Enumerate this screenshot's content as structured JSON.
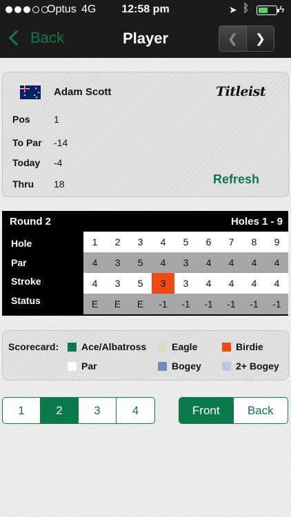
{
  "status_bar": {
    "signal_dots_filled": 3,
    "signal_dots_total": 5,
    "carrier": "Optus",
    "network": "4G",
    "time": "12:58 pm",
    "battery_level": 0.55,
    "icons": [
      "location-arrow-icon",
      "bluetooth-icon",
      "battery-icon",
      "charging-bolt-icon"
    ]
  },
  "nav": {
    "back_label": "Back",
    "title": "Player",
    "prev_icon": "chevron-left-icon",
    "next_icon": "chevron-right-icon"
  },
  "player": {
    "country_flag": "australia-flag-icon",
    "name": "Adam Scott",
    "sponsor": "Titleist",
    "stats": [
      {
        "label": "Pos",
        "value": "1"
      },
      {
        "label": "To Par",
        "value": "-14"
      },
      {
        "label": "Today",
        "value": "-4"
      },
      {
        "label": "Thru",
        "value": "18"
      }
    ],
    "refresh_label": "Refresh"
  },
  "scorecard": {
    "round_label": "Round 2",
    "holes_label": "Holes 1 - 9",
    "row_labels": {
      "hole": "Hole",
      "par": "Par",
      "stroke": "Stroke",
      "status": "Status"
    },
    "holes": [
      "1",
      "2",
      "3",
      "4",
      "5",
      "6",
      "7",
      "8",
      "9"
    ],
    "par": [
      "4",
      "3",
      "5",
      "4",
      "3",
      "4",
      "4",
      "4",
      "4"
    ],
    "stroke": [
      "4",
      "3",
      "5",
      "3",
      "3",
      "4",
      "4",
      "4",
      "4"
    ],
    "status": [
      "E",
      "E",
      "E",
      "-1",
      "-1",
      "-1",
      "-1",
      "-1",
      "-1"
    ],
    "birdie_holes": [
      4
    ]
  },
  "legend": {
    "title": "Scorecard:",
    "items": [
      {
        "label": "Ace/Albatross",
        "color": "#0b7a4b"
      },
      {
        "label": "Eagle",
        "color": "#cfe3c4"
      },
      {
        "label": "Birdie",
        "color": "#f04a14"
      },
      {
        "label": "Par",
        "color": "#ffffff"
      },
      {
        "label": "Bogey",
        "color": "#6f8fba"
      },
      {
        "label": "2+ Bogey",
        "color": "#bccadb"
      }
    ]
  },
  "round_selector": {
    "options": [
      "1",
      "2",
      "3",
      "4"
    ],
    "selected": "2"
  },
  "nine_selector": {
    "options": [
      "Front",
      "Back"
    ],
    "selected": "Front"
  },
  "colors": {
    "accent": "#0b7a4b",
    "nav_bar": "#1b1b1b",
    "grid_background": "#000000",
    "birdie": "#f04a14"
  }
}
